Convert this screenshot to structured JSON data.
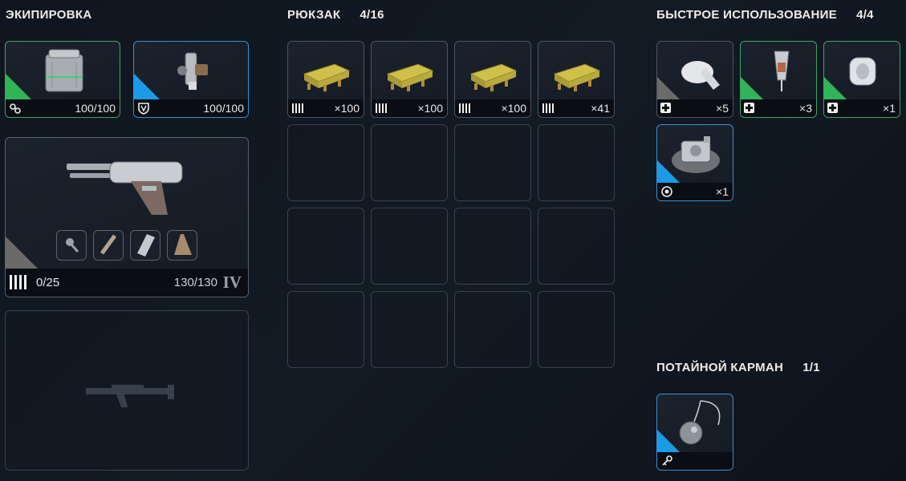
{
  "equipment": {
    "title": "ЭКИПИРОВКА",
    "armor": {
      "icon": "armor-case-icon",
      "durability": "100/100"
    },
    "backpack_item": {
      "icon": "device-rig-icon",
      "durability": "100/100"
    },
    "weapon": {
      "icon": "pistol-icon",
      "ammo": "0/25",
      "durability": "130/130",
      "tier": "IV",
      "mods": [
        "scope-mod-icon",
        "muzzle-mod-icon",
        "magazine-mod-icon",
        "stock-mod-icon"
      ]
    },
    "secondary": {
      "icon": "rifle-silhouette-icon"
    }
  },
  "backpack": {
    "title": "РЮКЗАК",
    "count": "4/16",
    "items": [
      {
        "icon": "ammo-box-icon",
        "qty": "×100"
      },
      {
        "icon": "ammo-box-icon",
        "qty": "×100"
      },
      {
        "icon": "ammo-box-icon",
        "qty": "×100"
      },
      {
        "icon": "ammo-box-icon",
        "qty": "×41"
      }
    ]
  },
  "quick": {
    "title": "БЫСТРОЕ ИСПОЛЬЗОВАНИЕ",
    "count": "4/4",
    "items": [
      {
        "icon": "bandage-icon",
        "qty": "×5",
        "rarity": "grey"
      },
      {
        "icon": "injector-icon",
        "qty": "×3",
        "rarity": "green"
      },
      {
        "icon": "gauze-roll-icon",
        "qty": "×1",
        "rarity": "green"
      },
      {
        "icon": "mine-device-icon",
        "qty": "×1",
        "rarity": "blue"
      }
    ]
  },
  "pocket": {
    "title": "ПОТАЙНОЙ КАРМАН",
    "count": "1/1",
    "item": {
      "icon": "pendant-key-icon"
    }
  },
  "colors": {
    "green": "#2fb457",
    "blue": "#1a9be8",
    "ammo_yellow": "#e8d64a"
  }
}
